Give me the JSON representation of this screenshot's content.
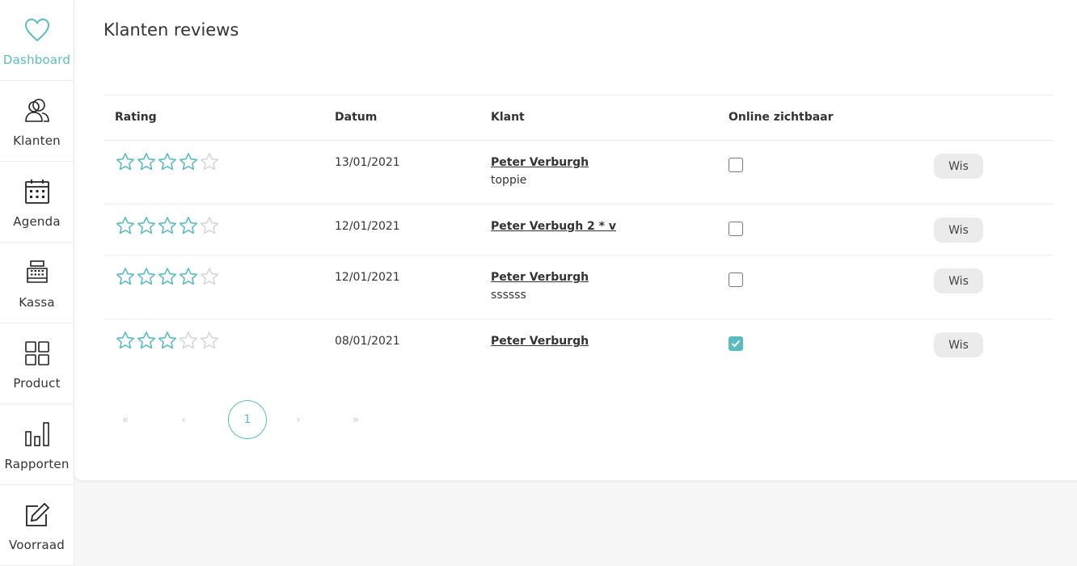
{
  "sidebar": {
    "items": [
      {
        "label": "Dashboard",
        "icon": "heart-icon",
        "active": true
      },
      {
        "label": "Klanten",
        "icon": "users-icon"
      },
      {
        "label": "Agenda",
        "icon": "calendar-icon"
      },
      {
        "label": "Kassa",
        "icon": "cash-register-icon"
      },
      {
        "label": "Product",
        "icon": "grid-icon"
      },
      {
        "label": "Rapporten",
        "icon": "bar-chart-icon"
      },
      {
        "label": "Voorraad",
        "icon": "edit-icon"
      }
    ]
  },
  "page": {
    "title": "Klanten reviews"
  },
  "table": {
    "headers": {
      "rating": "Rating",
      "datum": "Datum",
      "klant": "Klant",
      "online": "Online zichtbaar"
    },
    "rows": [
      {
        "rating": 4,
        "max_rating": 5,
        "date": "13/01/2021",
        "klant": "Peter Verburgh",
        "comment": "toppie",
        "online": false,
        "action": "Wis"
      },
      {
        "rating": 4,
        "max_rating": 5,
        "date": "12/01/2021",
        "klant": "Peter Verbugh 2 * v",
        "comment": "",
        "online": false,
        "action": "Wis"
      },
      {
        "rating": 4,
        "max_rating": 5,
        "date": "12/01/2021",
        "klant": "Peter Verburgh",
        "comment": "ssssss",
        "online": false,
        "action": "Wis"
      },
      {
        "rating": 3,
        "max_rating": 5,
        "date": "08/01/2021",
        "klant": "Peter Verburgh",
        "comment": "",
        "online": true,
        "action": "Wis"
      }
    ]
  },
  "pagination": {
    "first": "«",
    "prev": "‹",
    "current": "1",
    "next": "›",
    "last": "»"
  },
  "colors": {
    "accent": "#5bbcc0",
    "star_empty": "#d6d6d6"
  }
}
